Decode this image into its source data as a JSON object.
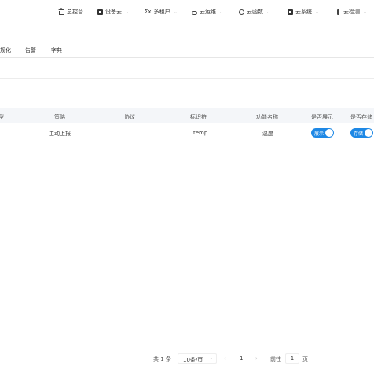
{
  "nav": {
    "items": [
      {
        "label": "总控台",
        "icon": "home-icon",
        "chevron": false
      },
      {
        "label": "设备云",
        "icon": "device-icon",
        "chevron": true
      },
      {
        "label": "多租户",
        "icon": "tenant-icon",
        "chevron": true
      },
      {
        "label": "云运维",
        "icon": "cloud-ops-icon",
        "chevron": true
      },
      {
        "label": "云函数",
        "icon": "cloud-function-icon",
        "chevron": true
      },
      {
        "label": "云系统",
        "icon": "cloud-system-icon",
        "chevron": true
      },
      {
        "label": "云检测",
        "icon": "cloud-detect-icon",
        "chevron": true
      }
    ],
    "tenant_prefix": "Σx"
  },
  "tabs": [
    "规化",
    "告警",
    "字典"
  ],
  "table": {
    "headers": [
      "型",
      "策略",
      "协议",
      "标识符",
      "功能名称",
      "是否展示",
      "是否存储"
    ],
    "rows": [
      {
        "strategy": "主动上报",
        "protocol": "",
        "identifier": "temp",
        "name": "温度",
        "show": "展示",
        "store": "存储"
      }
    ]
  },
  "pagination": {
    "total_text": "共 1 条",
    "page_size": "10条/页",
    "prev": "‹",
    "page": "1",
    "next": "›",
    "goto_label": "前往",
    "goto_value": "1",
    "goto_suffix": "页"
  },
  "colors": {
    "accent": "#1e88e5",
    "header_bg": "#f4f6f9"
  }
}
